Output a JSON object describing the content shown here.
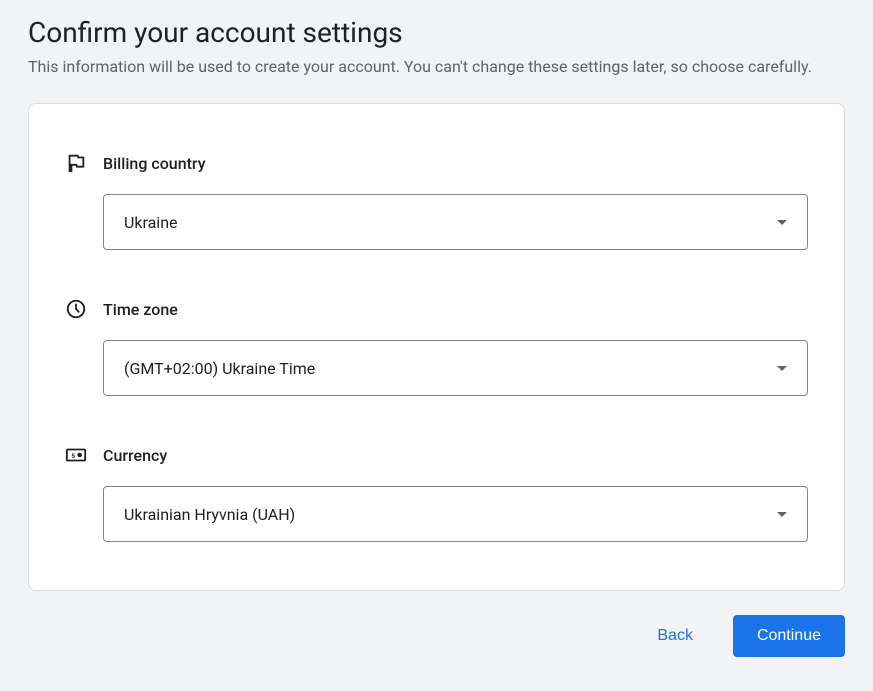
{
  "header": {
    "title": "Confirm your account settings",
    "subtitle": "This information will be used to create your account. You can't change these settings later, so choose carefully."
  },
  "fields": {
    "billing_country": {
      "label": "Billing country",
      "value": "Ukraine"
    },
    "time_zone": {
      "label": "Time zone",
      "value": "(GMT+02:00) Ukraine Time"
    },
    "currency": {
      "label": "Currency",
      "value": "Ukrainian Hryvnia (UAH)"
    }
  },
  "actions": {
    "back": "Back",
    "continue": "Continue"
  }
}
